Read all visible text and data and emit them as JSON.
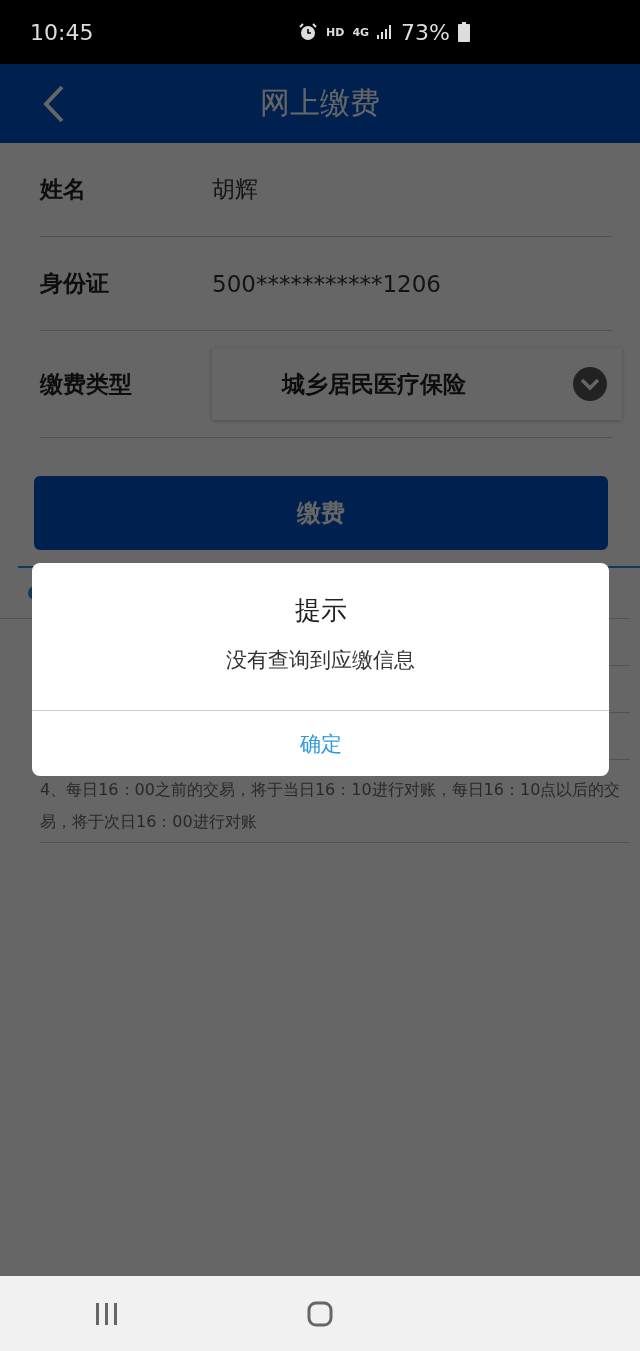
{
  "status_bar": {
    "time": "10:45",
    "hd": "HD",
    "network": "4G",
    "battery": "73%"
  },
  "header": {
    "title": "网上缴费"
  },
  "form": [
    {
      "label": "姓名",
      "value": "胡辉",
      "kind": "text"
    },
    {
      "label": "身份证",
      "value": "500***********1206",
      "kind": "text"
    },
    {
      "label": "缴费类型",
      "value": "城乡居民医疗保险",
      "kind": "select"
    }
  ],
  "pay_button": "缴费",
  "notes": [
    "4、每日16：00之前的交易，将于当日16：10进行对账，每日16：10点以后的交易，将于次日16：00进行对账"
  ],
  "dialog": {
    "title": "提示",
    "message": "没有查询到应缴信息",
    "button": "确定"
  }
}
